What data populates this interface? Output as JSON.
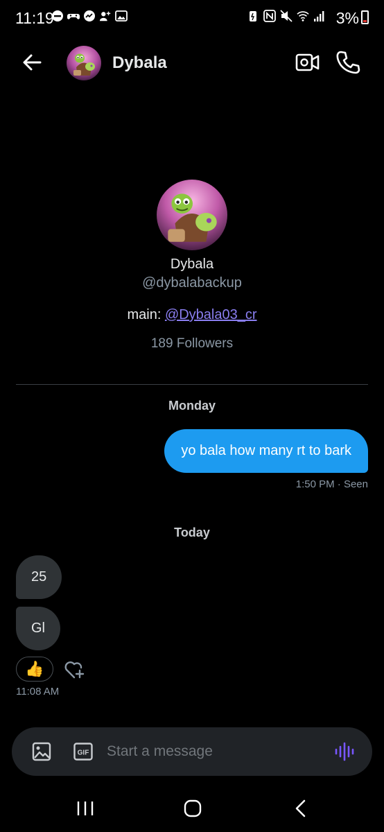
{
  "status_bar": {
    "time": "11:19",
    "battery": "3%",
    "battery_color": "#e53935"
  },
  "header": {
    "name": "Dybala",
    "icons": [
      "back-arrow-icon",
      "avatar",
      "video-camera-icon",
      "phone-icon"
    ]
  },
  "profile": {
    "name": "Dybala",
    "handle": "@dybalabackup",
    "bio_prefix": "main: ",
    "bio_link": "@Dybala03_cr",
    "followers": "189 Followers"
  },
  "conversation": {
    "day1_label": "Monday",
    "sent_message": "yo bala how many rt to bark",
    "sent_meta": "1:50 PM · Seen",
    "day2_label": "Today",
    "received_messages": [
      "25",
      "Gl"
    ],
    "reaction": "👍",
    "received_meta": "11:08 AM"
  },
  "composer": {
    "placeholder": "Start a message",
    "gif_label": "GIF"
  },
  "colors": {
    "background": "#000000",
    "sent_bubble": "#1d9bf0",
    "received_bubble": "#2f3336",
    "link": "#8a7ef0",
    "voice_accent": "#7856ff"
  }
}
